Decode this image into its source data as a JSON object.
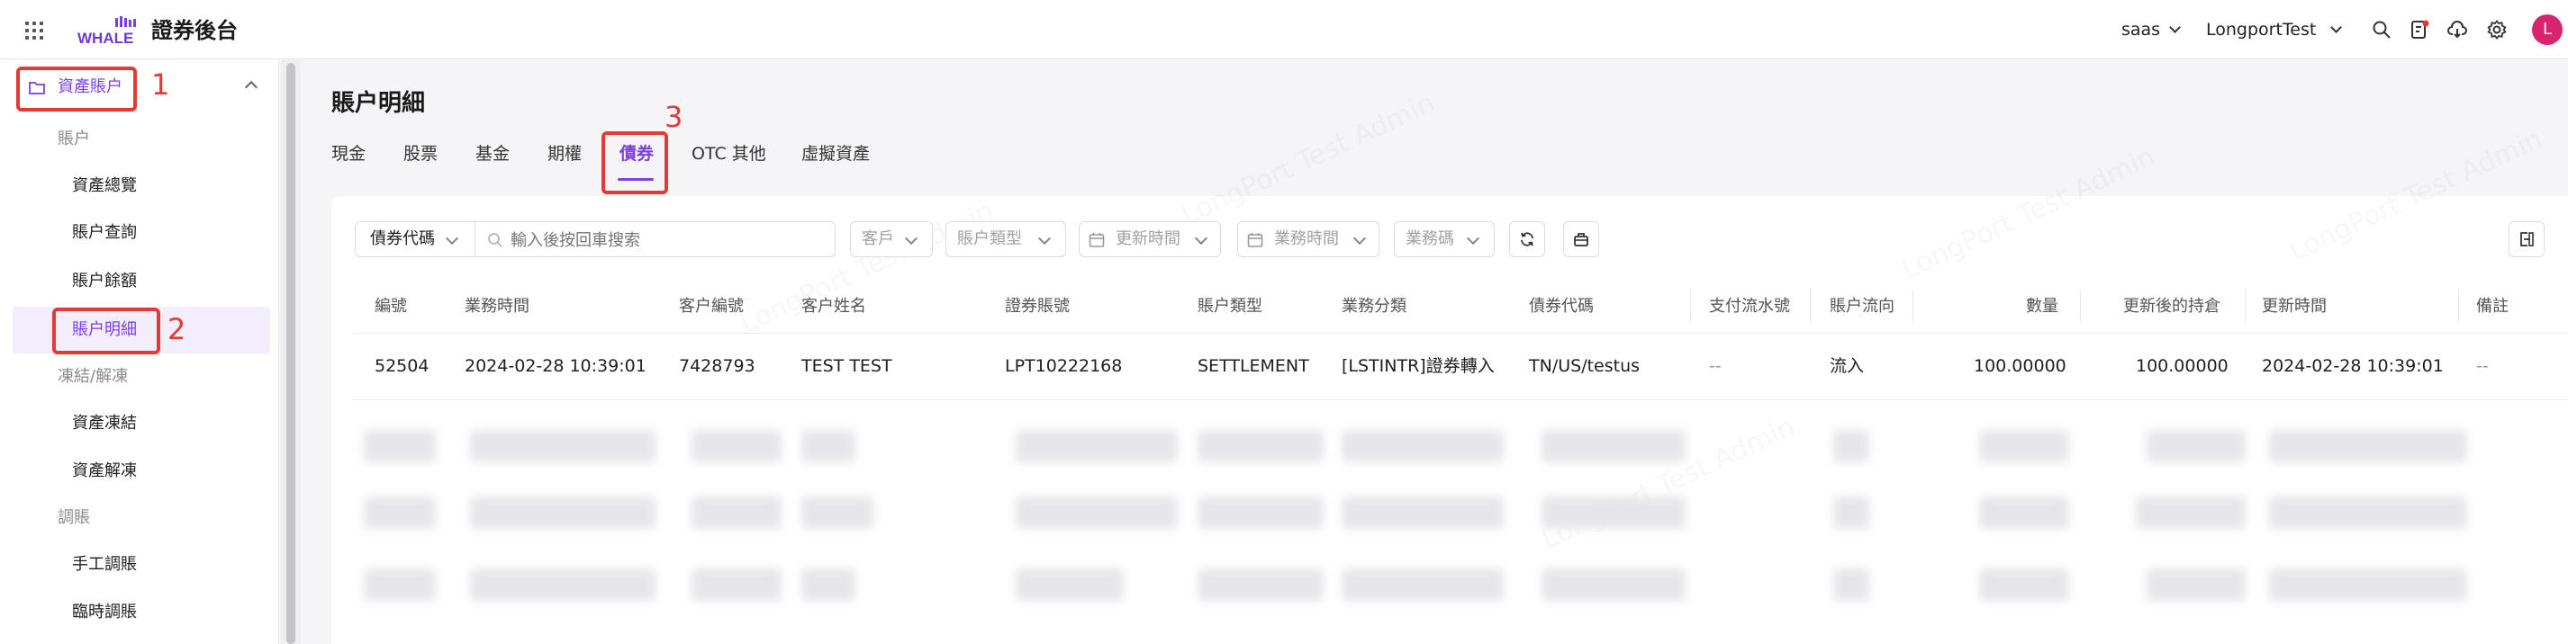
{
  "header": {
    "logo_small": "LONGBRIDGE",
    "logo_text": "WHALE",
    "title": "證券後台",
    "env": "saas",
    "tenant": "LongportTest",
    "avatar": "L"
  },
  "sidebar": {
    "group": "資產賬户",
    "sections": [
      {
        "label": "賬户",
        "items": [
          "資產總覽",
          "賬户查詢",
          "賬户餘額",
          "賬户明細"
        ]
      },
      {
        "label": "凍結/解凍",
        "items": [
          "資產凍結",
          "資產解凍"
        ]
      },
      {
        "label": "調賬",
        "items": [
          "手工調賬",
          "臨時調賬"
        ]
      }
    ],
    "active_item": "賬户明細"
  },
  "annotations": [
    "1",
    "2",
    "3"
  ],
  "main": {
    "title": "賬户明細",
    "tabs": [
      "現金",
      "股票",
      "基金",
      "期權",
      "債券",
      "OTC 其他",
      "虛擬資產"
    ],
    "active_tab": "債券"
  },
  "filters": {
    "search_type": "債券代碼",
    "search_placeholder": "輸入後按回車搜索",
    "dropdowns": [
      "客戶",
      "賬户類型",
      "更新時間",
      "業務時間",
      "業務碼"
    ]
  },
  "table": {
    "columns": [
      "編號",
      "業務時間",
      "客户編號",
      "客户姓名",
      "證券賬號",
      "賬户類型",
      "業務分類",
      "債券代碼",
      "支付流水號",
      "賬户流向",
      "數量",
      "更新後的持倉",
      "更新時間",
      "備註"
    ],
    "rows": [
      [
        "52504",
        "2024-02-28 10:39:01",
        "7428793",
        "TEST TEST",
        "LPT10222168",
        "SETTLEMENT",
        "[LSTINTR]證券轉入",
        "TN/US/testus",
        "--",
        "流入",
        "100.00000",
        "100.00000",
        "2024-02-28 10:39:01",
        "--"
      ]
    ]
  },
  "watermark": "LongPort Test Admin",
  "colors": {
    "accent": "#7b3fe4",
    "annotation": "#e53935",
    "avatar": "#d6246e"
  }
}
